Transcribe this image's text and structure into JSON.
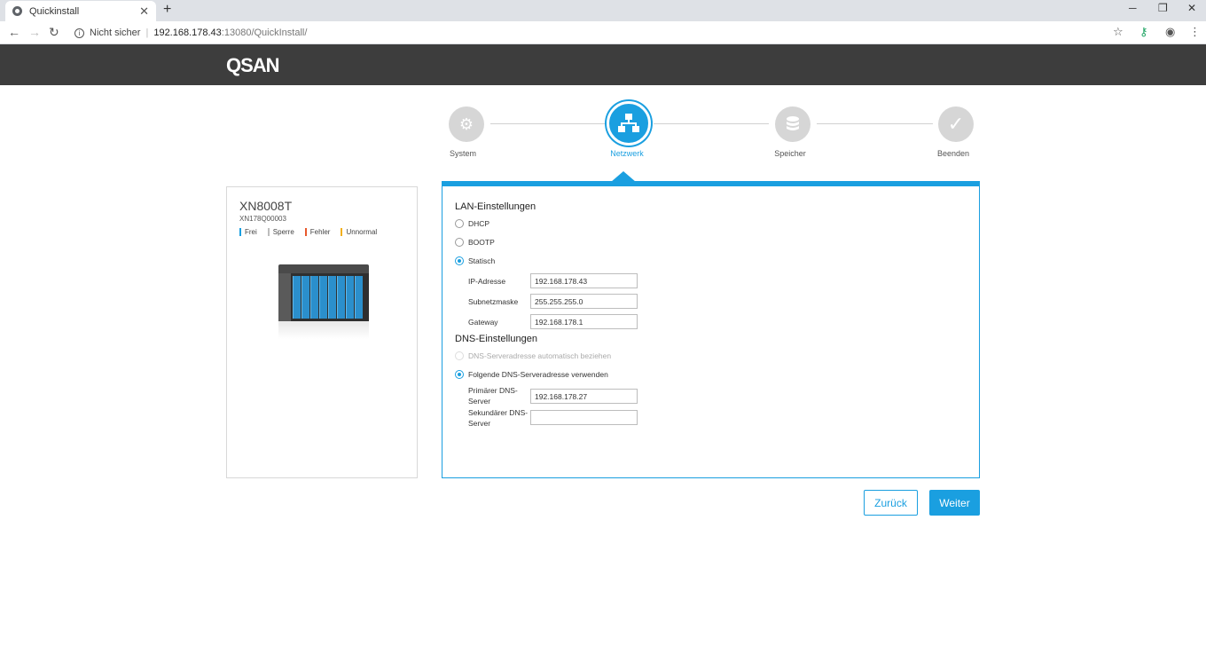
{
  "browser": {
    "tab_title": "Quickinstall",
    "new_tab": "+",
    "tab_close": "✕",
    "minimize": "─",
    "restore": "❐",
    "close": "✕",
    "security_label": "Nicht sicher",
    "url_host": "192.168.178.43",
    "url_path": ":13080/QuickInstall/"
  },
  "header": {
    "logo": "QSAN"
  },
  "stepper": {
    "steps": [
      {
        "label": "System",
        "icon": "gear-icon",
        "active": false
      },
      {
        "label": "Netzwerk",
        "icon": "network-icon",
        "active": true
      },
      {
        "label": "Speicher",
        "icon": "database-icon",
        "active": false
      },
      {
        "label": "Beenden",
        "icon": "check-icon",
        "active": false
      }
    ]
  },
  "device": {
    "model": "XN8008T",
    "serial": "XN178Q00003",
    "legend": [
      {
        "label": "Frei",
        "color": "#1a9fe0"
      },
      {
        "label": "Sperre",
        "color": "#bdbdbd"
      },
      {
        "label": "Fehler",
        "color": "#e8582c"
      },
      {
        "label": "Unnormal",
        "color": "#f2b01e"
      }
    ]
  },
  "lan": {
    "title": "LAN-Einstellungen",
    "options": [
      "DHCP",
      "BOOTP",
      "Statisch"
    ],
    "selected": "Statisch",
    "ip_label": "IP-Adresse",
    "ip_value": "192.168.178.43",
    "subnet_label": "Subnetzmaske",
    "subnet_value": "255.255.255.0",
    "gateway_label": "Gateway",
    "gateway_value": "192.168.178.1"
  },
  "dns": {
    "title": "DNS-Einstellungen",
    "auto_label": "DNS-Serveradresse automatisch beziehen",
    "manual_label": "Folgende DNS-Serveradresse verwenden",
    "primary_label": "Primärer DNS-Server",
    "primary_value": "192.168.178.27",
    "secondary_label": "Sekundärer DNS-Server",
    "secondary_value": ""
  },
  "buttons": {
    "back": "Zurück",
    "next": "Weiter"
  },
  "colors": {
    "accent": "#1a9fe0",
    "header_bg": "#3d3d3d"
  }
}
